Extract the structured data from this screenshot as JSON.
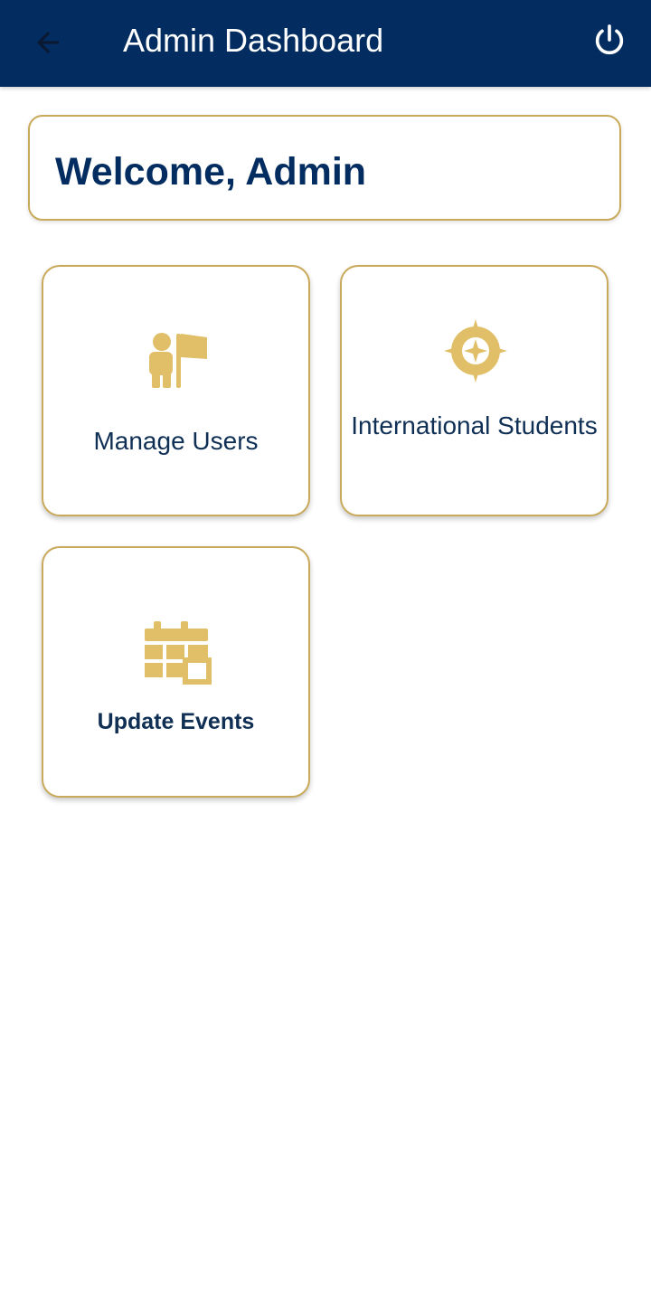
{
  "appbar": {
    "back_icon": "arrow-left-icon",
    "title": "Admin Dashboard",
    "power_icon": "power-icon"
  },
  "welcome": {
    "text": "Welcome, Admin"
  },
  "tiles": [
    {
      "label": "Manage Users",
      "icon": "user-flag-icon"
    },
    {
      "label": "International Students",
      "icon": "compass-icon"
    },
    {
      "label": "Update Events",
      "icon": "calendar-icon"
    }
  ],
  "colors": {
    "primary": "#032d60",
    "accent_gold": "#e0bf68",
    "border_gold": "#c9a95a",
    "text_dark": "#0f2f55"
  }
}
